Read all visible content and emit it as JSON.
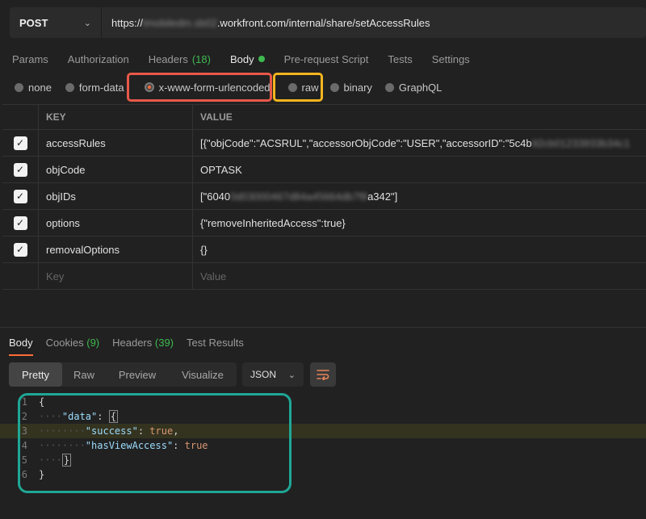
{
  "request": {
    "method": "POST",
    "url_prefix": "https://",
    "url_blurred": "tmobiledm.sb02",
    "url_suffix": ".workfront.com/internal/share/setAccessRules"
  },
  "request_tabs": [
    {
      "label": "Params"
    },
    {
      "label": "Authorization"
    },
    {
      "label": "Headers",
      "count": "(18)"
    },
    {
      "label": "Body",
      "active": true,
      "indicator": "green-dot"
    },
    {
      "label": "Pre-request Script"
    },
    {
      "label": "Tests"
    },
    {
      "label": "Settings"
    }
  ],
  "body_types": [
    {
      "label": "none"
    },
    {
      "label": "form-data"
    },
    {
      "label": "x-www-form-urlencoded",
      "selected": true
    },
    {
      "label": "raw"
    },
    {
      "label": "binary"
    },
    {
      "label": "GraphQL"
    }
  ],
  "kv_table": {
    "headers": {
      "key": "KEY",
      "value": "VALUE"
    },
    "rows": [
      {
        "checked": true,
        "key": "accessRules",
        "value_visible": "[{\"objCode\":\"ACSRUL\",\"accessorObjCode\":\"USER\",\"accessorID\":\"5c4b",
        "value_blurred": "92cb01233933b34c1"
      },
      {
        "checked": true,
        "key": "objCode",
        "value_visible": "OPTASK",
        "value_blurred": ""
      },
      {
        "checked": true,
        "key": "objIDs",
        "value_visible": "[\"6040",
        "value_blurred": "0d03000467d84a45664db7f8",
        "value_tail": "a342\"]"
      },
      {
        "checked": true,
        "key": "options",
        "value_visible": "{\"removeInheritedAccess\":true}",
        "value_blurred": ""
      },
      {
        "checked": true,
        "key": "removalOptions",
        "value_visible": "{}",
        "value_blurred": ""
      }
    ],
    "placeholder": {
      "key": "Key",
      "value": "Value"
    }
  },
  "response_tabs": [
    {
      "label": "Body",
      "active": true
    },
    {
      "label": "Cookies",
      "count": "(9)"
    },
    {
      "label": "Headers",
      "count": "(39)"
    },
    {
      "label": "Test Results"
    }
  ],
  "view_modes": [
    "Pretty",
    "Raw",
    "Preview",
    "Visualize"
  ],
  "active_view": "Pretty",
  "format": "JSON",
  "code_lines": [
    "1",
    "2",
    "3",
    "4",
    "5",
    "6"
  ],
  "code": {
    "open_brace": "{",
    "data_key": "\"data\"",
    "success_key": "\"success\"",
    "success_val": "true",
    "hasview_key": "\"hasViewAccess\"",
    "hasview_val": "true",
    "close_brace": "}"
  },
  "icons": {
    "method_dropdown": "chevron-down-icon",
    "format_dropdown": "chevron-down-icon",
    "wrap": "wrap-lines-icon",
    "checkbox": "checkmark-icon"
  },
  "colors": {
    "accent": "#ff6c37",
    "count_green": "#3fb950",
    "highlight_red": "#e8584a",
    "highlight_yellow": "#f5b51e",
    "highlight_teal": "#1fa796"
  }
}
